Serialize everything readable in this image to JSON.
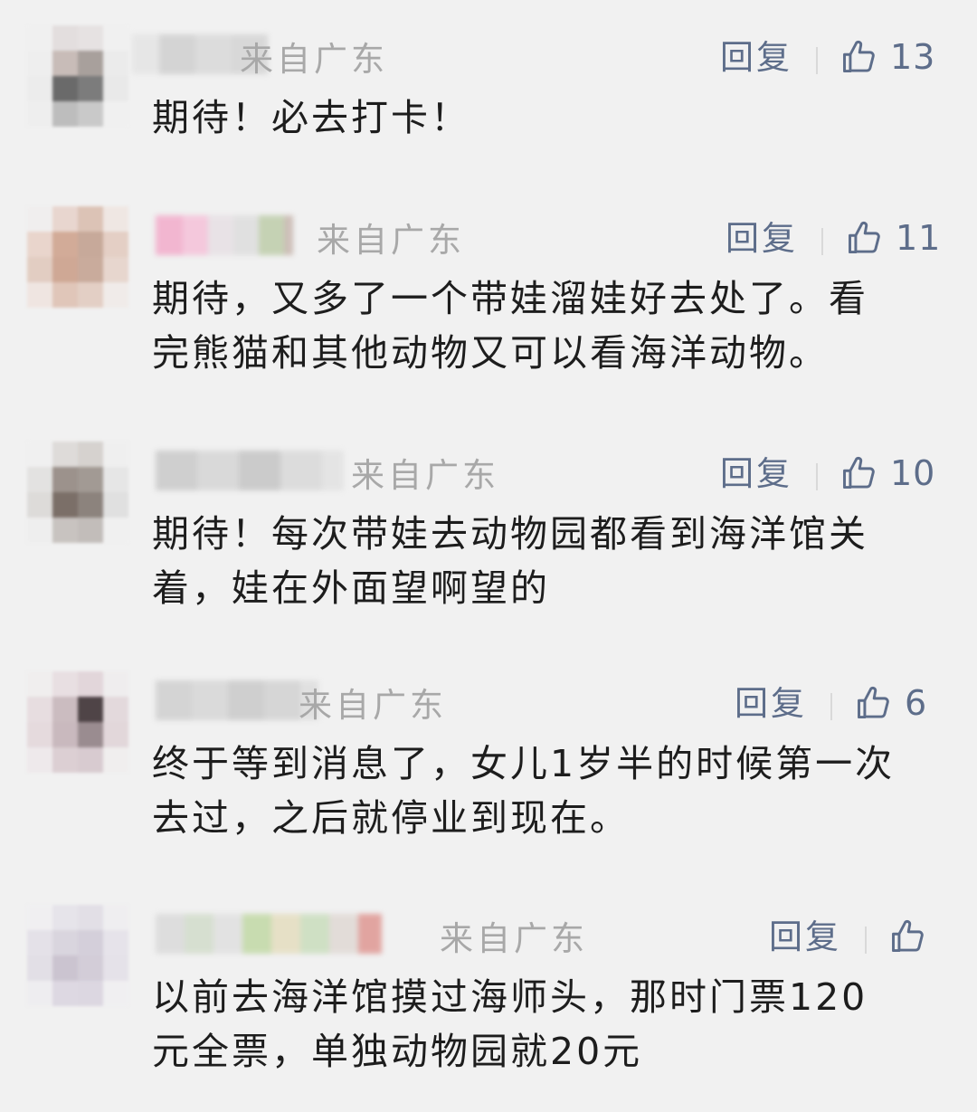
{
  "comments": [
    {
      "location": "来自广东",
      "reply_label": "回复",
      "like_count": "13",
      "text": "期待！必去打卡！"
    },
    {
      "location": "来自广东",
      "reply_label": "回复",
      "like_count": "11",
      "text": "期待，又多了一个带娃溜娃好去处了。看\n完熊猫和其他动物又可以看海洋动物。"
    },
    {
      "location": "来自广东",
      "reply_label": "回复",
      "like_count": "10",
      "text": "期待！每次带娃去动物园都看到海洋馆关\n着，娃在外面望啊望的"
    },
    {
      "location": "来自广东",
      "reply_label": "回复",
      "like_count": "6",
      "text": "终于等到消息了，女儿1岁半的时候第一次\n去过，之后就停业到现在。"
    },
    {
      "location": "来自广东",
      "reply_label": "回复",
      "like_count": "",
      "text": "以前去海洋馆摸过海师头，那时门票120\n元全票，单独动物园就20元"
    }
  ],
  "icons": {
    "like": "thumbs-up-icon"
  },
  "colors": {
    "background": "#f1f1f1",
    "action": "#5d6d8a",
    "location": "#a8a8a8",
    "text": "#1d1d1d"
  }
}
